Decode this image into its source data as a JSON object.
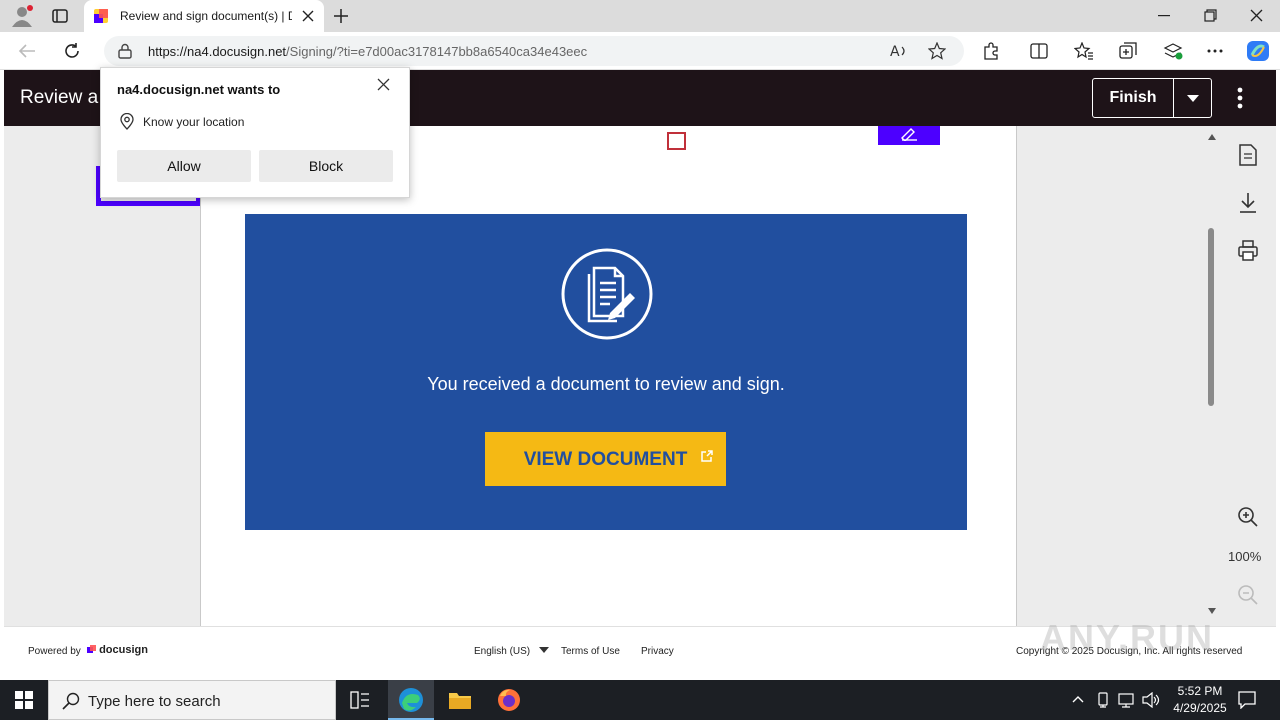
{
  "browser": {
    "tab_title": "Review and sign document(s) | D",
    "url_host": "https://na4.docusign.net",
    "url_path": "/Signing/?ti=e7d00ac3178147bb8a6540ca34e43eec"
  },
  "app": {
    "title": "Review a",
    "finish_label": "Finish"
  },
  "document": {
    "message": "You received a document to review and sign.",
    "button_label": "VIEW DOCUMENT",
    "banner_color": "#214f9f",
    "button_color": "#f5b914"
  },
  "zoom": {
    "level": "100%"
  },
  "permission_popup": {
    "title": "na4.docusign.net wants to",
    "permission": "Know your location",
    "allow_label": "Allow",
    "block_label": "Block"
  },
  "footer": {
    "powered_by": "Powered by",
    "brand": "docusign",
    "language": "English (US)",
    "terms": "Terms of Use",
    "privacy": "Privacy",
    "copyright": "Copyright © 2025 Docusign, Inc. All rights reserved"
  },
  "watermark": "ANY.RUN",
  "taskbar": {
    "search_placeholder": "Type here to search",
    "time": "5:52 PM",
    "date": "4/29/2025"
  }
}
